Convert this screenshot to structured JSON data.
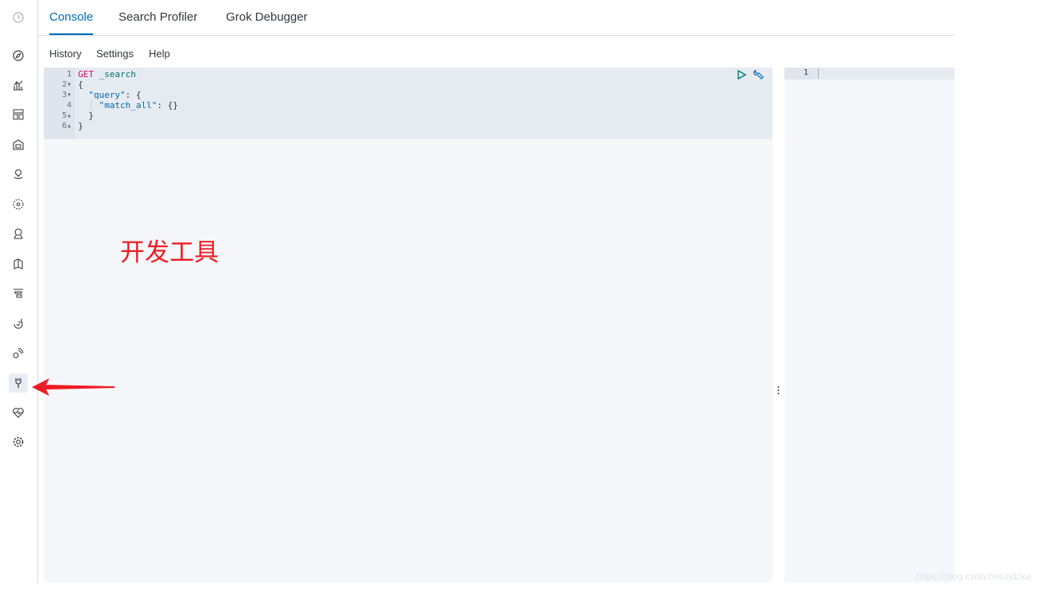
{
  "tabs": [
    {
      "label": "Console",
      "selected": true
    },
    {
      "label": "Search Profiler",
      "selected": false
    },
    {
      "label": "Grok Debugger",
      "selected": false
    }
  ],
  "menu": {
    "history": "History",
    "settings": "Settings",
    "help": "Help"
  },
  "editor": {
    "lines": [
      {
        "num": "1",
        "fold": "",
        "method": "GET",
        "path": " _search"
      },
      {
        "num": "2",
        "fold": "▾",
        "text": "{"
      },
      {
        "num": "3",
        "fold": "▾",
        "key": "\"query\"",
        "rest": ": {"
      },
      {
        "num": "4",
        "fold": "",
        "key": "\"match_all\"",
        "rest": ": {}"
      },
      {
        "num": "5",
        "fold": "▴",
        "text": "  }"
      },
      {
        "num": "6",
        "fold": "▴",
        "text": "}"
      }
    ],
    "actions": [
      "run-icon",
      "wrench-icon"
    ]
  },
  "output": {
    "line_number": "1"
  },
  "overlay": {
    "text": "开发工具"
  },
  "watermark": "https://blog.csdn.net/zjdzka",
  "nav_icons": [
    "clock-icon",
    "discover-icon",
    "visualize-icon",
    "dashboard-icon",
    "canvas-icon",
    "maps-icon",
    "ml-icon",
    "graph-icon",
    "logs-icon",
    "apm-icon",
    "uptime-icon",
    "signals-icon",
    "dev-tools-icon",
    "monitoring-icon",
    "management-icon"
  ],
  "colors": {
    "accent": "#006bb4",
    "method": "#c80a68",
    "path": "#00726b",
    "annotation": "#ee1c24"
  }
}
